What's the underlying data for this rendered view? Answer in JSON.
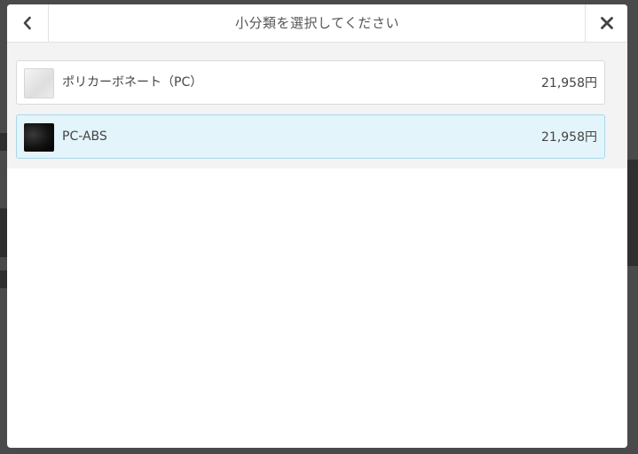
{
  "modal": {
    "title": "小分類を選択してください",
    "back_icon": "chevron-left-icon",
    "close_icon": "close-icon"
  },
  "items": [
    {
      "name": "ポリカーボネート（PC）",
      "price": "21,958円",
      "thumbnail": "light-plastic-swatch",
      "selected": false
    },
    {
      "name": "PC-ABS",
      "price": "21,958円",
      "thumbnail": "black-plastic-swatch",
      "selected": true
    }
  ],
  "colors": {
    "selected_bg": "#e3f4fa",
    "selected_border": "#a9d8ea",
    "text": "#444444"
  }
}
